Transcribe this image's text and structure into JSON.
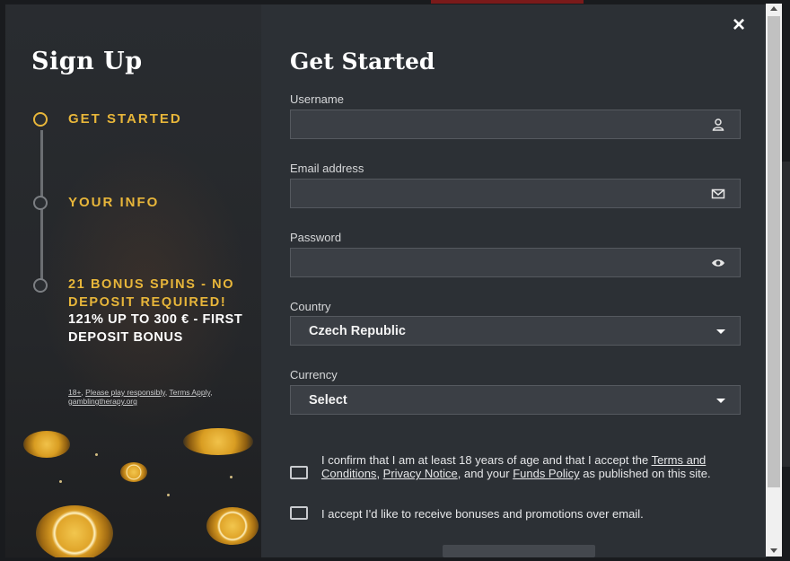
{
  "modal": {
    "close_glyph": "×"
  },
  "sidebar": {
    "title": "Sign Up",
    "steps": [
      {
        "label": "GET STARTED",
        "active": true
      },
      {
        "label": "YOUR INFO",
        "active": false
      }
    ],
    "bonus": {
      "line_gold": "21 BONUS SPINS - NO DEPOSIT REQUIRED!",
      "line_white": "121% UP TO 300 € - FIRST DEPOSIT BONUS"
    },
    "disclaimer": {
      "age": "18+",
      "sep1": ", ",
      "play_responsibly": "Please play responsibly",
      "sep2": ", ",
      "terms": "Terms Apply",
      "sep3": ", ",
      "site": "gamblingtherapy.org"
    }
  },
  "form": {
    "title": "Get Started",
    "username": {
      "label": "Username",
      "value": "",
      "icon": "user-icon"
    },
    "email": {
      "label": "Email address",
      "value": "",
      "icon": "envelope-icon"
    },
    "password": {
      "label": "Password",
      "value": "",
      "icon": "eye-icon"
    },
    "country": {
      "label": "Country",
      "selected": "Czech Republic"
    },
    "currency": {
      "label": "Currency",
      "selected": "Select"
    },
    "consent_age": {
      "text_before": "I confirm that I am at least 18 years of age and that I accept the ",
      "link_terms": "Terms and Conditions",
      "sep1": ", ",
      "link_privacy": "Privacy Notice",
      "mid": ", and your ",
      "link_funds": "Funds Policy",
      "text_after": " as published on this site."
    },
    "consent_marketing": {
      "text": "I accept I'd like to receive bonuses and promotions over email."
    }
  },
  "colors": {
    "accent_gold": "#e8b63a",
    "modal_bg": "#2c3035",
    "input_bg": "#3b3f45"
  }
}
